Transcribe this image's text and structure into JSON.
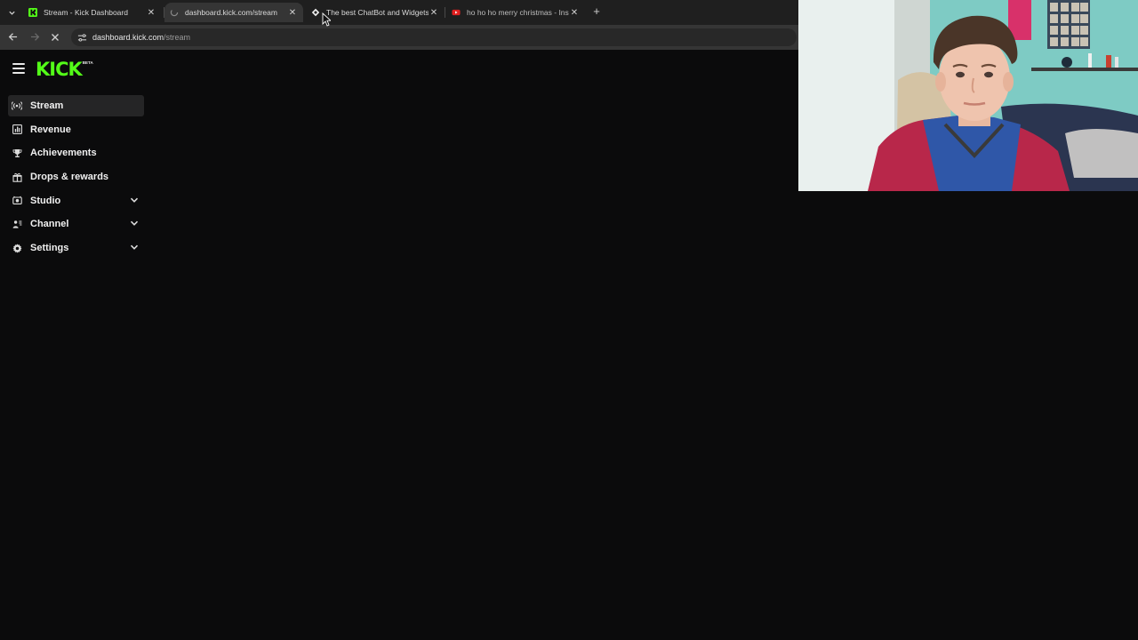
{
  "browser": {
    "tabs": [
      {
        "title": "Stream - Kick Dashboard",
        "favicon": "kick-icon",
        "active": false
      },
      {
        "title": "dashboard.kick.com/stream",
        "favicon": "loading-spinner-icon",
        "active": true
      },
      {
        "title": "The best ChatBot and Widgets",
        "favicon": "botrix-icon",
        "active": false
      },
      {
        "title": "ho ho ho merry christmas - Inst",
        "favicon": "youtube-icon",
        "active": false
      }
    ],
    "new_tab_icon": "plus-icon",
    "address": {
      "host": "dashboard.kick.com",
      "path": "/stream"
    }
  },
  "app": {
    "logo_text": "KICK",
    "logo_badge": "BETA",
    "brand_color": "#53fc18",
    "nav": [
      {
        "label": "Stream",
        "icon": "broadcast-icon",
        "active": true,
        "expandable": false
      },
      {
        "label": "Revenue",
        "icon": "revenue-chart-icon",
        "active": false,
        "expandable": false
      },
      {
        "label": "Achievements",
        "icon": "trophy-icon",
        "active": false,
        "expandable": false
      },
      {
        "label": "Drops & rewards",
        "icon": "gift-icon",
        "active": false,
        "expandable": false
      },
      {
        "label": "Studio",
        "icon": "studio-icon",
        "active": false,
        "expandable": true
      },
      {
        "label": "Channel",
        "icon": "channel-icon",
        "active": false,
        "expandable": true
      },
      {
        "label": "Settings",
        "icon": "gear-icon",
        "active": false,
        "expandable": true
      }
    ]
  },
  "overlay": {
    "type": "webcam"
  }
}
